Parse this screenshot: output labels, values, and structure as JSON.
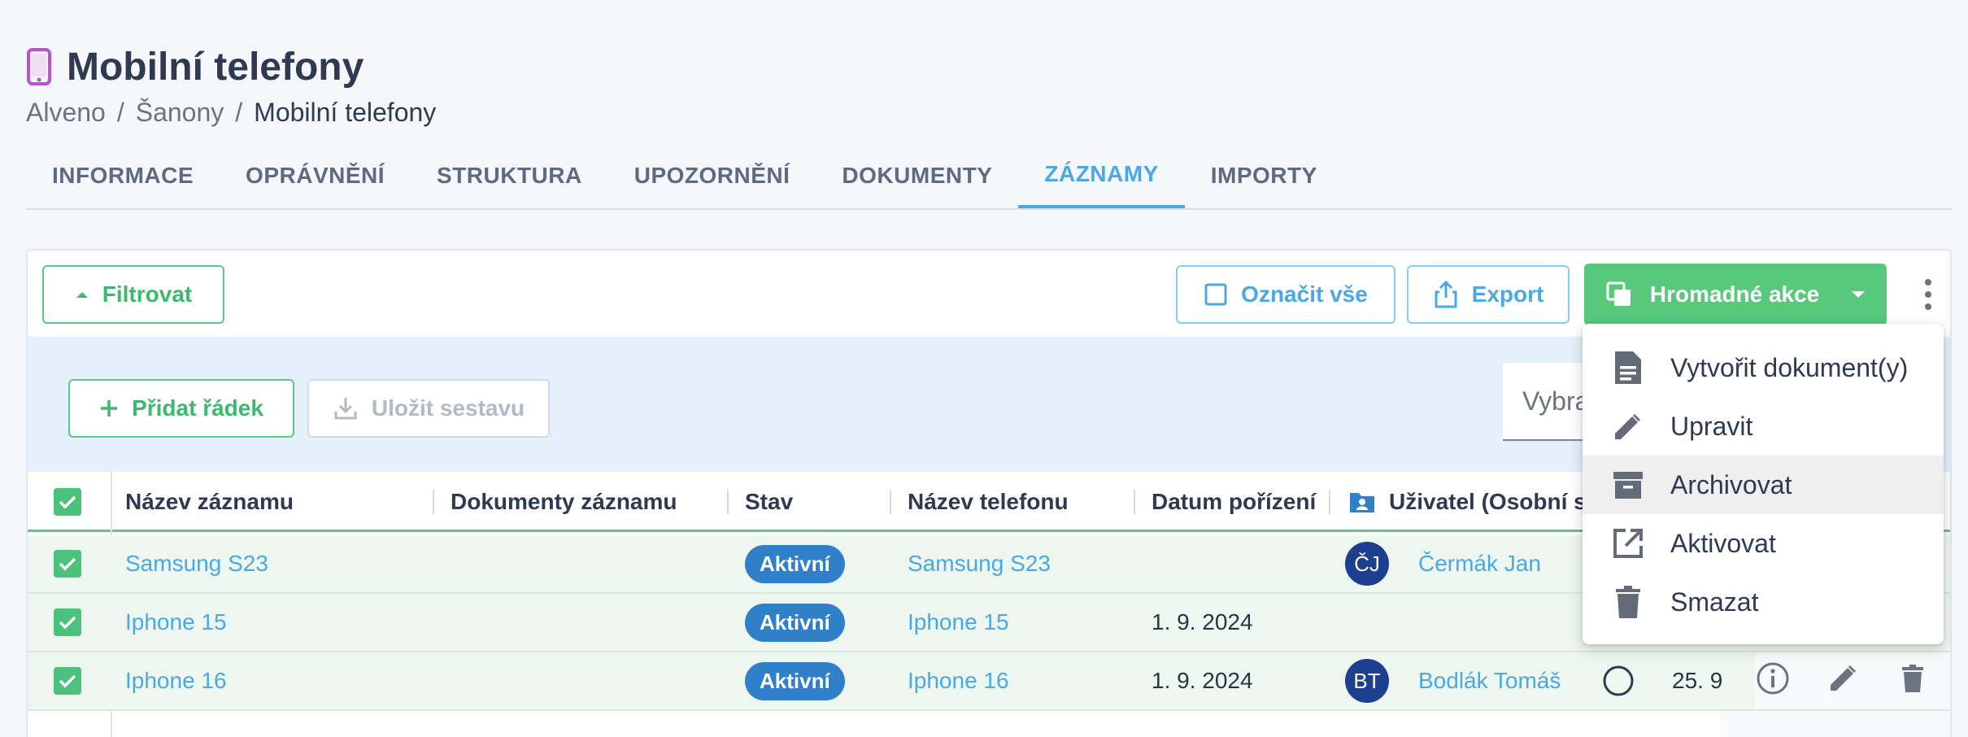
{
  "page": {
    "title": "Mobilní telefony"
  },
  "breadcrumb": {
    "items": [
      "Alveno",
      "Šanony",
      "Mobilní telefony"
    ],
    "sep": "/"
  },
  "tabs": [
    {
      "label": "INFORMACE"
    },
    {
      "label": "OPRÁVNĚNÍ"
    },
    {
      "label": "STRUKTURA"
    },
    {
      "label": "UPOZORNĚNÍ"
    },
    {
      "label": "DOKUMENTY"
    },
    {
      "label": "ZÁZNAMY",
      "active": true
    },
    {
      "label": "IMPORTY"
    }
  ],
  "toolbar": {
    "filter_label": "Filtrovat",
    "select_all_label": "Označit vše",
    "export_label": "Export",
    "bulk_label": "Hromadné akce"
  },
  "subtoolbar": {
    "add_row_label": "Přidat řádek",
    "save_report_label": "Uložit sestavu",
    "select_placeholder": "Vybra"
  },
  "table": {
    "columns": [
      "Název záznamu",
      "Dokumenty záznamu",
      "Stav",
      "Název telefonu",
      "Datum pořízení",
      "Uživatel (Osobní s"
    ],
    "rows": [
      {
        "name": "Samsung S23",
        "status": "Aktivní",
        "phone": "Samsung S23",
        "date": "",
        "initials": "ČJ",
        "user": "Čermák Jan"
      },
      {
        "name": "Iphone 15",
        "status": "Aktivní",
        "phone": "Iphone 15",
        "date": "1. 9. 2024",
        "initials": "",
        "user": ""
      },
      {
        "name": "Iphone 16",
        "status": "Aktivní",
        "phone": "Iphone 16",
        "date": "1. 9. 2024",
        "initials": "BT",
        "user": "Bodlák Tomáš",
        "extra_date": "25. 9"
      }
    ]
  },
  "dropdown": {
    "items": [
      {
        "label": "Vytvořit dokument(y)",
        "icon": "document-icon"
      },
      {
        "label": "Upravit",
        "icon": "pencil-icon"
      },
      {
        "label": "Archivovat",
        "icon": "archive-icon"
      },
      {
        "label": "Aktivovat",
        "icon": "open-external-icon"
      },
      {
        "label": "Smazat",
        "icon": "trash-icon"
      }
    ]
  },
  "colors": {
    "accent": "#4aa8e6",
    "green": "#58c97b",
    "badge": "#2f80c8",
    "title_icon": "#c04fd6"
  }
}
